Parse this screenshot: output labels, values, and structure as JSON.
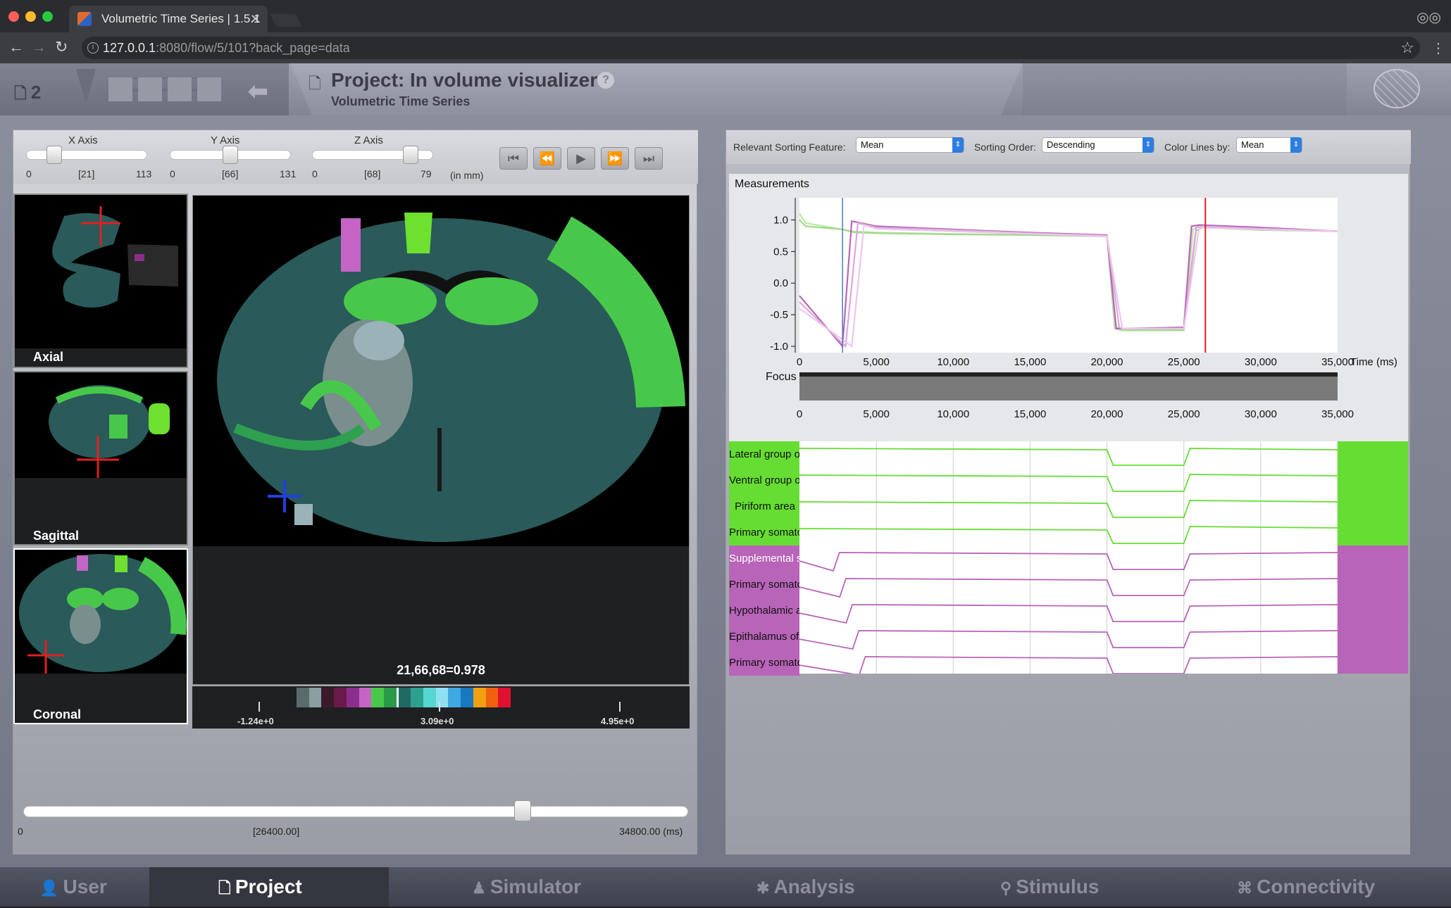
{
  "browser": {
    "tab_title": "Volumetric Time Series | 1.5.1",
    "url_host": "127.0.0.1",
    "url_path": ":8080/flow/5/101?back_page=data"
  },
  "header": {
    "project_count": "2",
    "title": "Project: In volume visualizer",
    "subtitle": "Volumetric Time Series",
    "help": "?"
  },
  "axes": {
    "x": {
      "label": "X Axis",
      "min": "0",
      "value": "[21]",
      "max": "113",
      "fraction": 0.19
    },
    "y": {
      "label": "Y Axis",
      "min": "0",
      "value": "[66]",
      "max": "131",
      "fraction": 0.5
    },
    "z": {
      "label": "Z Axis",
      "min": "0",
      "value": "[68]",
      "max": "79",
      "fraction": 0.86
    },
    "unit": "(in mm)"
  },
  "views": {
    "axial": "Axial",
    "sagittal": "Sagittal",
    "coronal": "Coronal"
  },
  "readout": "21,66,68=0.978",
  "legend": {
    "min": "-1.24e+0",
    "mid": "3.09e+0",
    "max": "4.95e+0",
    "colors": [
      "#5b6b6b",
      "#8aa0a0",
      "#3a1a2a",
      "#6a1a4a",
      "#8c2f8c",
      "#c464c4",
      "#48c84a",
      "#2a9a4a",
      "#fff",
      "#1f6a62",
      "#2da090",
      "#56d6d0",
      "#8ee0f0",
      "#40a8e0",
      "#1878c0",
      "#f0a010",
      "#f06010",
      "#e01030"
    ]
  },
  "time": {
    "min": "0",
    "current": "[26400.00]",
    "max": "34800.00 (ms)",
    "fraction": 0.758
  },
  "sorting": {
    "feature_label": "Relevant Sorting Feature:",
    "feature_value": "Mean",
    "order_label": "Sorting Order:",
    "order_value": "Descending",
    "color_label": "Color Lines by:",
    "color_value": "Mean"
  },
  "measurements": {
    "title": "Measurements",
    "focus_label": "Focus",
    "time_label": "Time (ms)"
  },
  "chart_data": {
    "type": "line",
    "title": "Measurements",
    "xlabel": "Time (ms)",
    "ylabel": "",
    "xlim": [
      0,
      35000
    ],
    "ylim": [
      -1.1,
      1.35
    ],
    "xticks": [
      "0",
      "5,000",
      "10,000",
      "15,000",
      "20,000",
      "25,000",
      "30,000",
      "35,000"
    ],
    "yticks": [
      "-1.0",
      "-0.5",
      "0.0",
      "0.5",
      "1.0"
    ],
    "cursor_time": 2800,
    "current_time": 26400,
    "series": [
      {
        "color": "#b8e8a0",
        "x": [
          0,
          400,
          2800,
          3400,
          5000,
          10000,
          15000,
          20000,
          20500,
          21000,
          25000,
          25600,
          26000,
          30000,
          35000
        ],
        "y": [
          1.1,
          0.95,
          0.85,
          0.82,
          0.8,
          0.78,
          0.76,
          0.75,
          -0.72,
          -0.75,
          -0.75,
          0.85,
          0.9,
          0.85,
          0.82
        ]
      },
      {
        "color": "#a2d98c",
        "x": [
          0,
          400,
          2800,
          3600,
          5000,
          10000,
          15000,
          20000,
          20600,
          21000,
          25000,
          25800,
          26200,
          30000,
          35000
        ],
        "y": [
          1.0,
          0.9,
          0.85,
          0.8,
          0.79,
          0.77,
          0.76,
          0.74,
          -0.7,
          -0.74,
          -0.74,
          0.83,
          0.88,
          0.84,
          0.82
        ]
      },
      {
        "color": "#b866b8",
        "x": [
          0,
          2800,
          3400,
          5000,
          10000,
          15000,
          20000,
          20600,
          21000,
          25000,
          25500,
          26000,
          30000,
          35000
        ],
        "y": [
          -0.2,
          -1.0,
          0.98,
          0.9,
          0.85,
          0.8,
          0.76,
          -0.72,
          -0.72,
          -0.7,
          0.9,
          0.92,
          0.88,
          0.82
        ]
      },
      {
        "color": "#dca8dc",
        "x": [
          0,
          3000,
          3800,
          5000,
          10000,
          15000,
          20000,
          20800,
          21000,
          25000,
          25800,
          26200,
          30000,
          35000
        ],
        "y": [
          -0.3,
          -1.0,
          0.95,
          0.88,
          0.84,
          0.79,
          0.75,
          -0.7,
          -0.72,
          -0.72,
          0.88,
          0.9,
          0.86,
          0.82
        ]
      },
      {
        "color": "#ecc6ec",
        "x": [
          0,
          3400,
          4200,
          5000,
          10000,
          15000,
          20000,
          21000,
          25000,
          26000,
          30000,
          35000
        ],
        "y": [
          -0.4,
          -1.0,
          0.92,
          0.86,
          0.82,
          0.78,
          0.74,
          -0.72,
          -0.72,
          0.88,
          0.85,
          0.82
        ]
      }
    ]
  },
  "traces": [
    {
      "label": "Lateral group of the dorsal thalamus",
      "group": "green"
    },
    {
      "label": "Ventral group of the dorsal thalamus",
      "group": "green"
    },
    {
      "label": "Piriform area",
      "group": "green"
    },
    {
      "label": "Primary somatosensory area, lower limb",
      "group": "green"
    },
    {
      "label": "Supplemental somatosensory area",
      "group": "pink"
    },
    {
      "label": "Primary somatosensory area, unassigned",
      "group": "pink"
    },
    {
      "label": "Hypothalamic area",
      "group": "pink"
    },
    {
      "label": "Epithalamus of the thalamus",
      "group": "pink"
    },
    {
      "label": "Primary somatosensory area, upper limb",
      "group": "pink"
    }
  ],
  "colors": {
    "green": "#66dd33",
    "pink": "#b864b8",
    "app_bg": "#8c909e"
  },
  "menu": {
    "user": "User",
    "project": "Project",
    "simulator": "Simulator",
    "analysis": "Analysis",
    "stimulus": "Stimulus",
    "connectivity": "Connectivity"
  }
}
